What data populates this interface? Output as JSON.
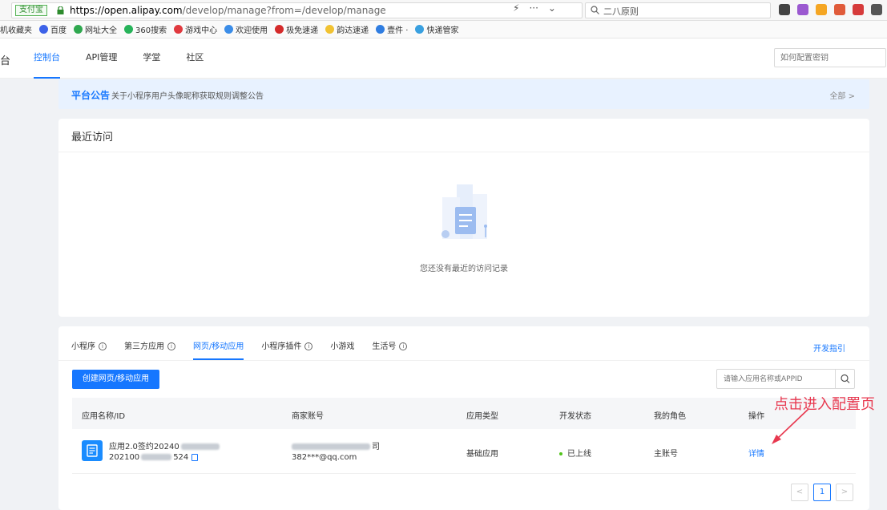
{
  "browser": {
    "site_badge": "支付宝",
    "url_host": "https://open.alipay.com",
    "url_path": "/develop/manage?from=/develop/manage",
    "addr_tools": [
      "⚡",
      "···",
      "⌄"
    ],
    "search_text": "二八原则",
    "tray_colors": [
      "#444444",
      "#9b59d0",
      "#f5a623",
      "#e05b3a",
      "#d63b3b",
      "#555555"
    ]
  },
  "bookmarks": [
    {
      "label": "机收藏夹",
      "color": "#f3b33d"
    },
    {
      "label": "百度",
      "color": "#3d62e8"
    },
    {
      "label": "网址大全",
      "color": "#2fa84f"
    },
    {
      "label": "360搜索",
      "color": "#27b35a"
    },
    {
      "label": "游戏中心",
      "color": "#e0393e"
    },
    {
      "label": "欢迎使用",
      "color": "#3b8de8"
    },
    {
      "label": "极免速递",
      "color": "#d42a2a"
    },
    {
      "label": "韵达速递",
      "color": "#f1c232"
    },
    {
      "label": "壹件 ·",
      "color": "#2f7de1"
    },
    {
      "label": "快递管家",
      "color": "#39a0e0"
    }
  ],
  "header": {
    "logo_fragment": "台",
    "nav": [
      "控制台",
      "API管理",
      "学堂",
      "社区"
    ],
    "help_placeholder": "如何配置密钥"
  },
  "notice": {
    "tag": "平台公告",
    "text": "关于小程序用户头像昵称获取规则调整公告",
    "more": "全部 >"
  },
  "recent": {
    "title": "最近访问",
    "empty_text": "您还没有最近的访问记录"
  },
  "apps": {
    "tabs": [
      {
        "label": "小程序",
        "info": "i"
      },
      {
        "label": "第三方应用",
        "info": "i"
      },
      {
        "label": "网页/移动应用",
        "info": ""
      },
      {
        "label": "小程序插件",
        "info": "i"
      },
      {
        "label": "小游戏",
        "info": ""
      },
      {
        "label": "生活号",
        "info": "i"
      }
    ],
    "dev_guide": "开发指引",
    "create_button": "创建网页/移动应用",
    "search_placeholder": "请输入应用名称或APPID",
    "columns": [
      "应用名称/ID",
      "商家账号",
      "应用类型",
      "开发状态",
      "我的角色",
      "操作"
    ],
    "row": {
      "name": "应用2.0签约20240",
      "id_prefix": "202100",
      "id_suffix": "524",
      "merchant_suffix": "司",
      "email": "382***@qq.com",
      "type": "基础应用",
      "status": "已上线",
      "role": "主账号",
      "action": "详情"
    },
    "pager": {
      "prev": "<",
      "current": "1",
      "next": ">"
    }
  },
  "annotation": {
    "text": "点击进入配置页",
    "color": "#e8384f"
  }
}
